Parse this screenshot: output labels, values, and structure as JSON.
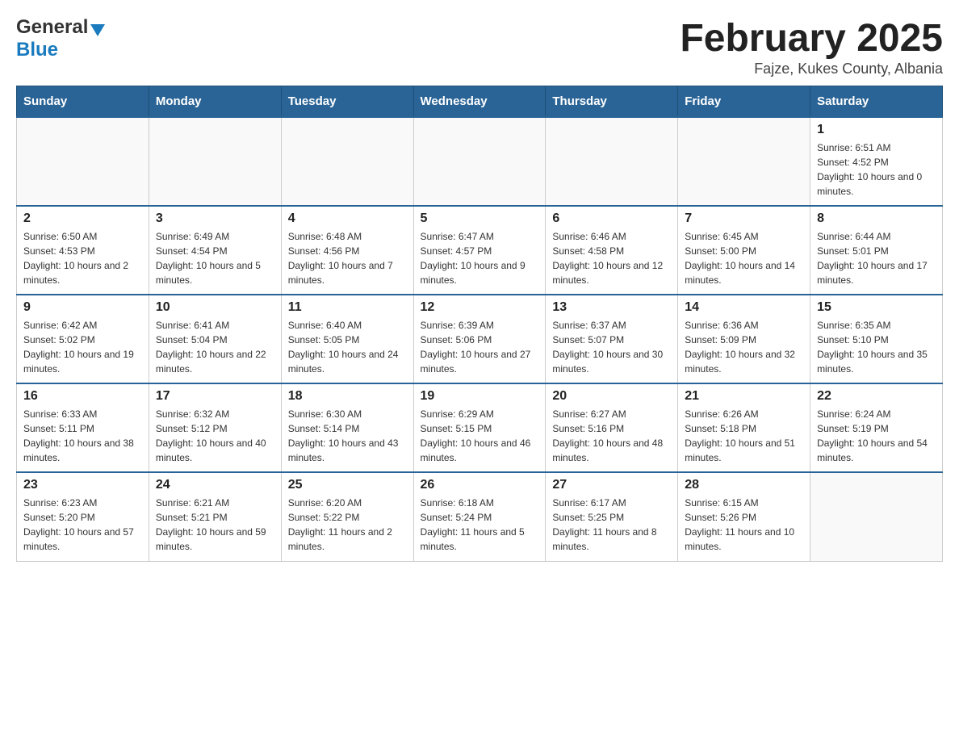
{
  "logo": {
    "general": "General",
    "blue": "Blue"
  },
  "header": {
    "month_year": "February 2025",
    "location": "Fajze, Kukes County, Albania"
  },
  "weekdays": [
    "Sunday",
    "Monday",
    "Tuesday",
    "Wednesday",
    "Thursday",
    "Friday",
    "Saturday"
  ],
  "weeks": [
    [
      {
        "day": "",
        "info": ""
      },
      {
        "day": "",
        "info": ""
      },
      {
        "day": "",
        "info": ""
      },
      {
        "day": "",
        "info": ""
      },
      {
        "day": "",
        "info": ""
      },
      {
        "day": "",
        "info": ""
      },
      {
        "day": "1",
        "info": "Sunrise: 6:51 AM\nSunset: 4:52 PM\nDaylight: 10 hours and 0 minutes."
      }
    ],
    [
      {
        "day": "2",
        "info": "Sunrise: 6:50 AM\nSunset: 4:53 PM\nDaylight: 10 hours and 2 minutes."
      },
      {
        "day": "3",
        "info": "Sunrise: 6:49 AM\nSunset: 4:54 PM\nDaylight: 10 hours and 5 minutes."
      },
      {
        "day": "4",
        "info": "Sunrise: 6:48 AM\nSunset: 4:56 PM\nDaylight: 10 hours and 7 minutes."
      },
      {
        "day": "5",
        "info": "Sunrise: 6:47 AM\nSunset: 4:57 PM\nDaylight: 10 hours and 9 minutes."
      },
      {
        "day": "6",
        "info": "Sunrise: 6:46 AM\nSunset: 4:58 PM\nDaylight: 10 hours and 12 minutes."
      },
      {
        "day": "7",
        "info": "Sunrise: 6:45 AM\nSunset: 5:00 PM\nDaylight: 10 hours and 14 minutes."
      },
      {
        "day": "8",
        "info": "Sunrise: 6:44 AM\nSunset: 5:01 PM\nDaylight: 10 hours and 17 minutes."
      }
    ],
    [
      {
        "day": "9",
        "info": "Sunrise: 6:42 AM\nSunset: 5:02 PM\nDaylight: 10 hours and 19 minutes."
      },
      {
        "day": "10",
        "info": "Sunrise: 6:41 AM\nSunset: 5:04 PM\nDaylight: 10 hours and 22 minutes."
      },
      {
        "day": "11",
        "info": "Sunrise: 6:40 AM\nSunset: 5:05 PM\nDaylight: 10 hours and 24 minutes."
      },
      {
        "day": "12",
        "info": "Sunrise: 6:39 AM\nSunset: 5:06 PM\nDaylight: 10 hours and 27 minutes."
      },
      {
        "day": "13",
        "info": "Sunrise: 6:37 AM\nSunset: 5:07 PM\nDaylight: 10 hours and 30 minutes."
      },
      {
        "day": "14",
        "info": "Sunrise: 6:36 AM\nSunset: 5:09 PM\nDaylight: 10 hours and 32 minutes."
      },
      {
        "day": "15",
        "info": "Sunrise: 6:35 AM\nSunset: 5:10 PM\nDaylight: 10 hours and 35 minutes."
      }
    ],
    [
      {
        "day": "16",
        "info": "Sunrise: 6:33 AM\nSunset: 5:11 PM\nDaylight: 10 hours and 38 minutes."
      },
      {
        "day": "17",
        "info": "Sunrise: 6:32 AM\nSunset: 5:12 PM\nDaylight: 10 hours and 40 minutes."
      },
      {
        "day": "18",
        "info": "Sunrise: 6:30 AM\nSunset: 5:14 PM\nDaylight: 10 hours and 43 minutes."
      },
      {
        "day": "19",
        "info": "Sunrise: 6:29 AM\nSunset: 5:15 PM\nDaylight: 10 hours and 46 minutes."
      },
      {
        "day": "20",
        "info": "Sunrise: 6:27 AM\nSunset: 5:16 PM\nDaylight: 10 hours and 48 minutes."
      },
      {
        "day": "21",
        "info": "Sunrise: 6:26 AM\nSunset: 5:18 PM\nDaylight: 10 hours and 51 minutes."
      },
      {
        "day": "22",
        "info": "Sunrise: 6:24 AM\nSunset: 5:19 PM\nDaylight: 10 hours and 54 minutes."
      }
    ],
    [
      {
        "day": "23",
        "info": "Sunrise: 6:23 AM\nSunset: 5:20 PM\nDaylight: 10 hours and 57 minutes."
      },
      {
        "day": "24",
        "info": "Sunrise: 6:21 AM\nSunset: 5:21 PM\nDaylight: 10 hours and 59 minutes."
      },
      {
        "day": "25",
        "info": "Sunrise: 6:20 AM\nSunset: 5:22 PM\nDaylight: 11 hours and 2 minutes."
      },
      {
        "day": "26",
        "info": "Sunrise: 6:18 AM\nSunset: 5:24 PM\nDaylight: 11 hours and 5 minutes."
      },
      {
        "day": "27",
        "info": "Sunrise: 6:17 AM\nSunset: 5:25 PM\nDaylight: 11 hours and 8 minutes."
      },
      {
        "day": "28",
        "info": "Sunrise: 6:15 AM\nSunset: 5:26 PM\nDaylight: 11 hours and 10 minutes."
      },
      {
        "day": "",
        "info": ""
      }
    ]
  ]
}
